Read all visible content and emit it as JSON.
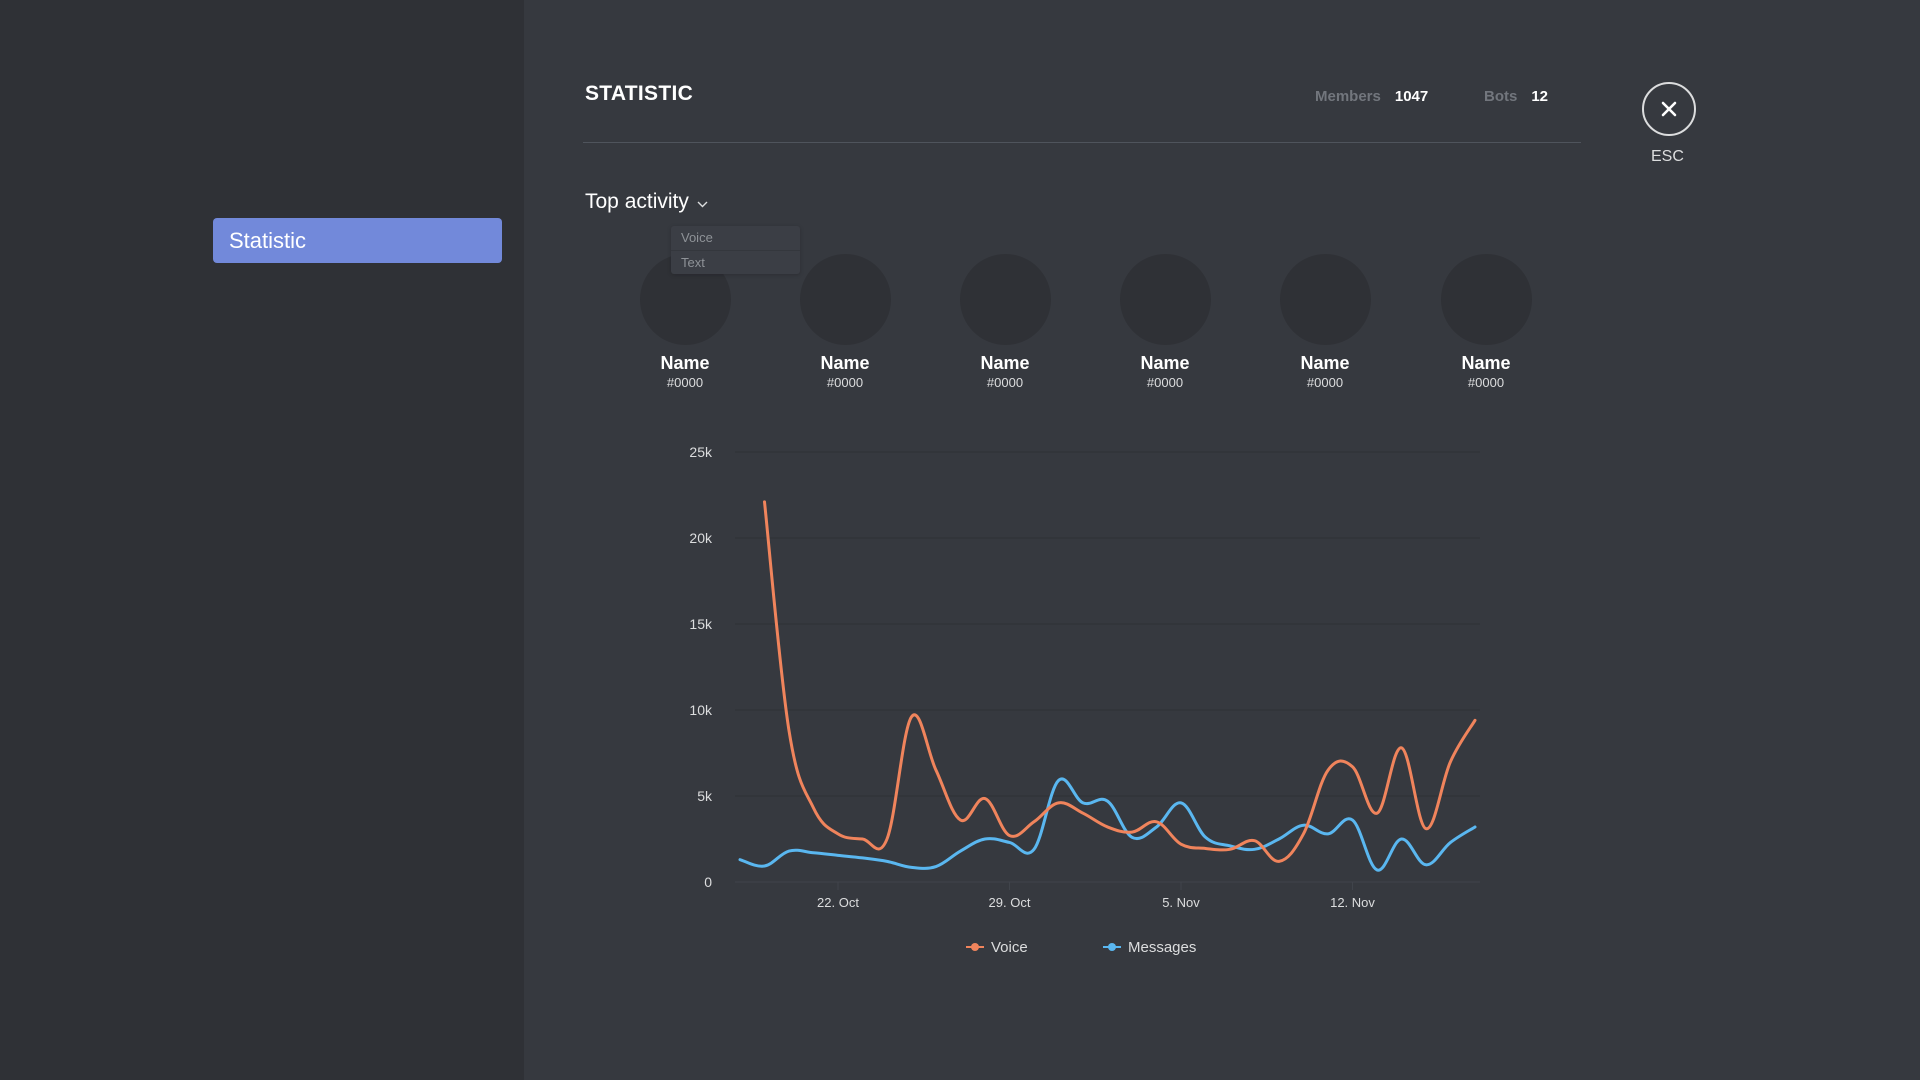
{
  "sidebar": {
    "items": [
      {
        "label": "Statistic",
        "active": true
      }
    ]
  },
  "header": {
    "title": "STATISTIC",
    "members_label": "Members",
    "members_value": "1047",
    "bots_label": "Bots",
    "bots_value": "12",
    "close_icon": "close-icon",
    "close_label": "ESC"
  },
  "top_activity": {
    "label": "Top activity",
    "icon": "chevron-down-icon",
    "dropdown_options": [
      "Voice",
      "Text"
    ]
  },
  "users": [
    {
      "name": "Name",
      "tag": "#0000"
    },
    {
      "name": "Name",
      "tag": "#0000"
    },
    {
      "name": "Name",
      "tag": "#0000"
    },
    {
      "name": "Name",
      "tag": "#0000"
    },
    {
      "name": "Name",
      "tag": "#0000"
    },
    {
      "name": "Name",
      "tag": "#0000"
    }
  ],
  "colors": {
    "accent": "#7289da",
    "voice": "#f0845c",
    "messages": "#5ab7f0"
  },
  "chart_data": {
    "type": "line",
    "title": "",
    "xlabel": "",
    "ylabel": "",
    "x_start": "18 Oct",
    "x_step": "1 day",
    "x_ticks": [
      {
        "label": "22. Oct",
        "index": 4
      },
      {
        "label": "29. Oct",
        "index": 11
      },
      {
        "label": "5. Nov",
        "index": 18
      },
      {
        "label": "12. Nov",
        "index": 25
      }
    ],
    "y_ticks": [
      {
        "label": "0",
        "value": 0
      },
      {
        "label": "5k",
        "value": 5000
      },
      {
        "label": "10k",
        "value": 10000
      },
      {
        "label": "15k",
        "value": 15000
      },
      {
        "label": "20k",
        "value": 20000
      },
      {
        "label": "25k",
        "value": 25000
      }
    ],
    "ylim": [
      0,
      25000
    ],
    "grid": true,
    "legend": "bottom-center",
    "series": [
      {
        "name": "Voice",
        "color": "#f0845c",
        "values": [
          null,
          22100,
          8800,
          4300,
          2800,
          2500,
          2500,
          9600,
          6500,
          3600,
          4850,
          2700,
          3500,
          4600,
          4000,
          3200,
          2900,
          3500,
          2200,
          1950,
          1900,
          2400,
          1200,
          2800,
          6500,
          6700,
          4000,
          7800,
          3100,
          7000,
          9400
        ]
      },
      {
        "name": "Messages",
        "color": "#5ab7f0",
        "values": [
          1300,
          930,
          1800,
          1700,
          1550,
          1400,
          1200,
          850,
          900,
          1800,
          2500,
          2300,
          1900,
          5900,
          4600,
          4700,
          2600,
          3200,
          4600,
          2600,
          2100,
          1900,
          2500,
          3300,
          2800,
          3600,
          700,
          2500,
          1000,
          2300,
          3200
        ]
      }
    ]
  }
}
